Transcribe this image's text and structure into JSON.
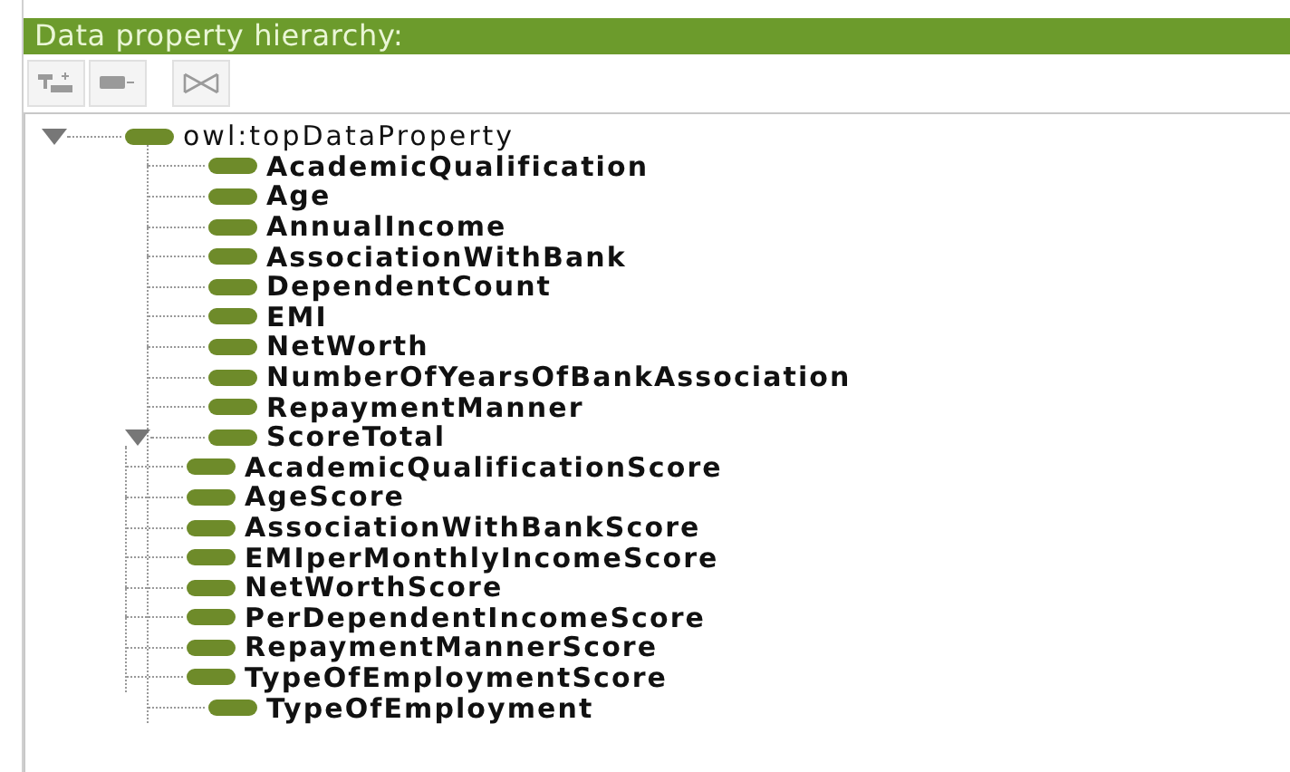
{
  "header": {
    "title": "Data property hierarchy:"
  },
  "toolbar": [
    {
      "kind": "add_sub",
      "disabled": true
    },
    {
      "kind": "add_sibling",
      "disabled": true
    },
    {
      "kind": "delete",
      "disabled": true
    }
  ],
  "tree": [
    {
      "label": "owl:topDataProperty",
      "expanded": true,
      "children": [
        {
          "label": "AcademicQualification"
        },
        {
          "label": "Age"
        },
        {
          "label": "AnnualIncome"
        },
        {
          "label": "AssociationWithBank"
        },
        {
          "label": "DependentCount"
        },
        {
          "label": "EMI"
        },
        {
          "label": "NetWorth"
        },
        {
          "label": "NumberOfYearsOfBankAssociation"
        },
        {
          "label": "RepaymentManner"
        },
        {
          "label": "ScoreTotal",
          "expanded": true,
          "children": [
            {
              "label": "AcademicQualificationScore"
            },
            {
              "label": "AgeScore"
            },
            {
              "label": "AssociationWithBankScore"
            },
            {
              "label": "EMIperMonthlyIncomeScore"
            },
            {
              "label": "NetWorthScore"
            },
            {
              "label": "PerDependentIncomeScore"
            },
            {
              "label": "RepaymentMannerScore"
            },
            {
              "label": "TypeOfEmploymentScore"
            }
          ]
        },
        {
          "label": "TypeOfEmployment"
        }
      ]
    }
  ]
}
